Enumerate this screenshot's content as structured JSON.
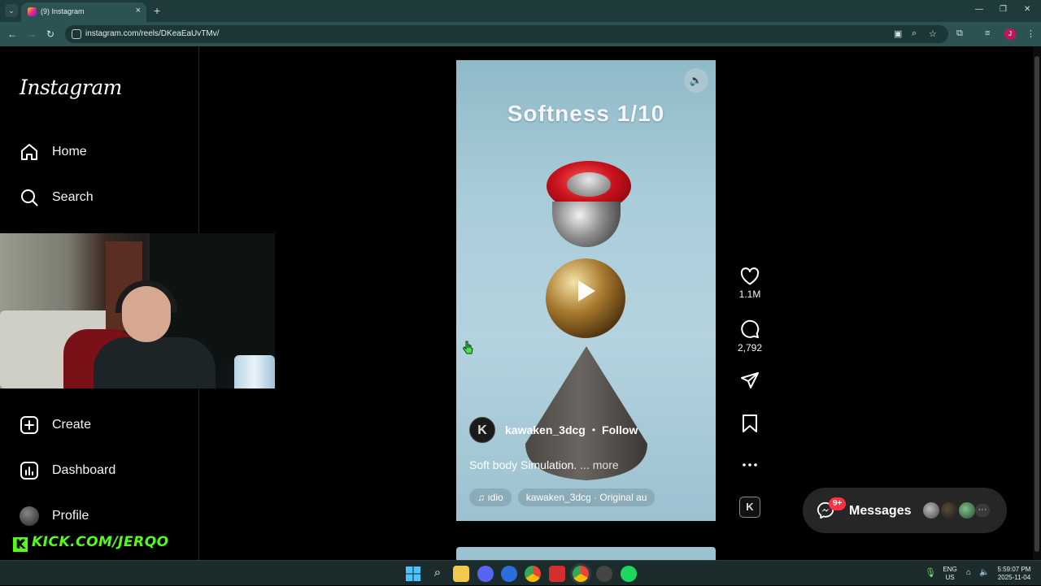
{
  "browser": {
    "tab_title": "(9) Instagram",
    "new_tab_label": "+",
    "url": "instagram.com/reels/DKeaEaUvTMv/"
  },
  "sidebar": {
    "logo": "Instagram",
    "items": [
      {
        "label": "Home",
        "icon": "home-icon"
      },
      {
        "label": "Search",
        "icon": "search-icon"
      },
      {
        "label": "Create",
        "icon": "create-icon"
      },
      {
        "label": "Dashboard",
        "icon": "dashboard-icon"
      },
      {
        "label": "Profile",
        "icon": "avatar"
      }
    ]
  },
  "overlay": {
    "kick_url": "KICK.COM/JERQO",
    "kick_logo": "K"
  },
  "reel": {
    "overlay_title": "Softness 1/10",
    "author": "kawaken_3dcg",
    "author_initial": "K",
    "separator": "•",
    "follow_label": "Follow",
    "caption": "Soft body Simulation.",
    "more_label": "... more",
    "audio_badge": "♫ ıdio",
    "audio_track": "kawaken_3dcg · Original au",
    "colors": {
      "ring": "#c8121c",
      "gold": "#a87a2e",
      "background": "#a9ccd9"
    }
  },
  "actions": {
    "likes": "1.1M",
    "comments": "2,792",
    "audio_thumb_initial": "K"
  },
  "messages": {
    "label": "Messages",
    "badge": "9+",
    "more": "···"
  },
  "taskbar": {
    "lang_top": "ENG",
    "lang_bottom": "US",
    "time": "5:59:07 PM",
    "date": "2025-11-04"
  }
}
